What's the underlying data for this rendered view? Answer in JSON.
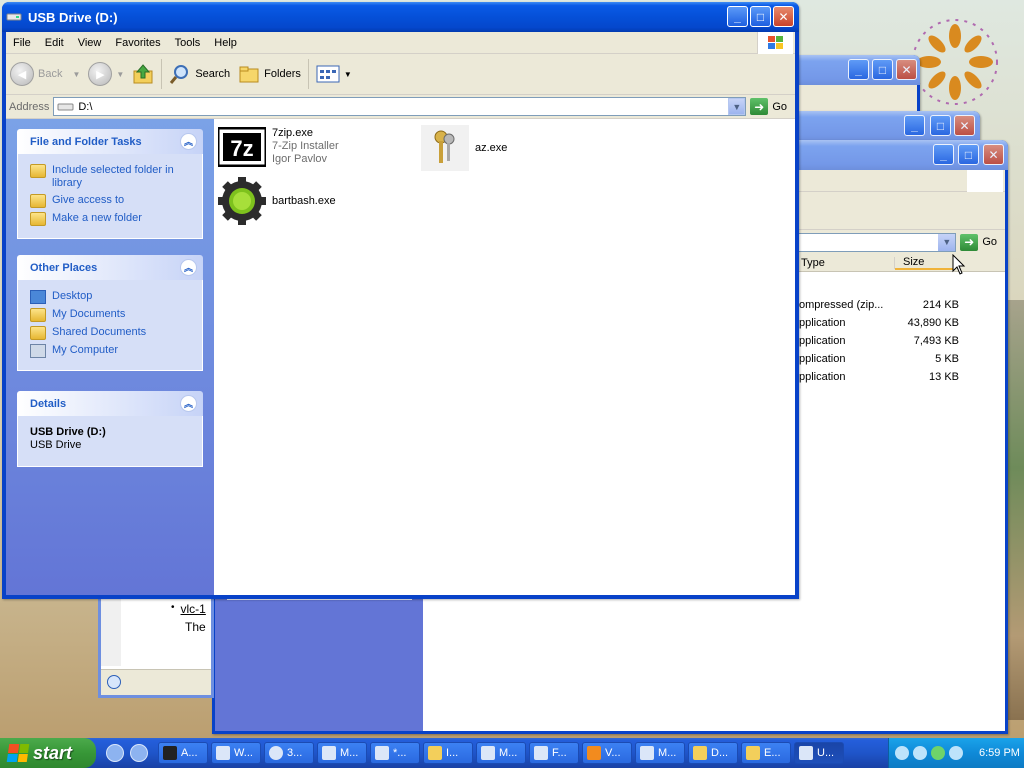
{
  "window": {
    "title": "USB Drive (D:)"
  },
  "menu": [
    "File",
    "Edit",
    "View",
    "Favorites",
    "Tools",
    "Help"
  ],
  "toolbar": {
    "back": "Back",
    "search": "Search",
    "folders": "Folders"
  },
  "address": {
    "label": "Address",
    "value": "D:\\",
    "go": "Go"
  },
  "tasks_panel": {
    "title": "File and Folder Tasks",
    "items": [
      "Include selected folder in library",
      "Give access to",
      "Make a new folder"
    ]
  },
  "places_panel": {
    "title": "Other Places",
    "items": [
      "Desktop",
      "My Documents",
      "Shared Documents",
      "My Computer"
    ]
  },
  "details_panel": {
    "title": "Details",
    "name": "USB Drive (D:)",
    "type": "USB Drive"
  },
  "files": [
    {
      "name": "7zip.exe",
      "line2": "7-Zip Installer",
      "line3": "Igor Pavlov"
    },
    {
      "name": "az.exe"
    },
    {
      "name": "bartbash.exe"
    }
  ],
  "bg_window": {
    "go": "Go",
    "col_type": "Type",
    "col_size": "Size",
    "rows": [
      {
        "type": "ompressed (zip...",
        "size": "214 KB"
      },
      {
        "type": "pplication",
        "size": "43,890 KB"
      },
      {
        "type": "pplication",
        "size": "7,493 KB"
      },
      {
        "type": "pplication",
        "size": "5 KB"
      },
      {
        "type": "pplication",
        "size": "13 KB"
      }
    ]
  },
  "bg_browser": {
    "link": "vlc-1",
    "text": "The"
  },
  "taskbar": {
    "start": "start",
    "tasks": [
      "A...",
      "W...",
      "3...",
      "M...",
      "*...",
      "I...",
      "M...",
      "F...",
      "V...",
      "M...",
      "D...",
      "E...",
      "U..."
    ],
    "clock": "6:59 PM"
  }
}
